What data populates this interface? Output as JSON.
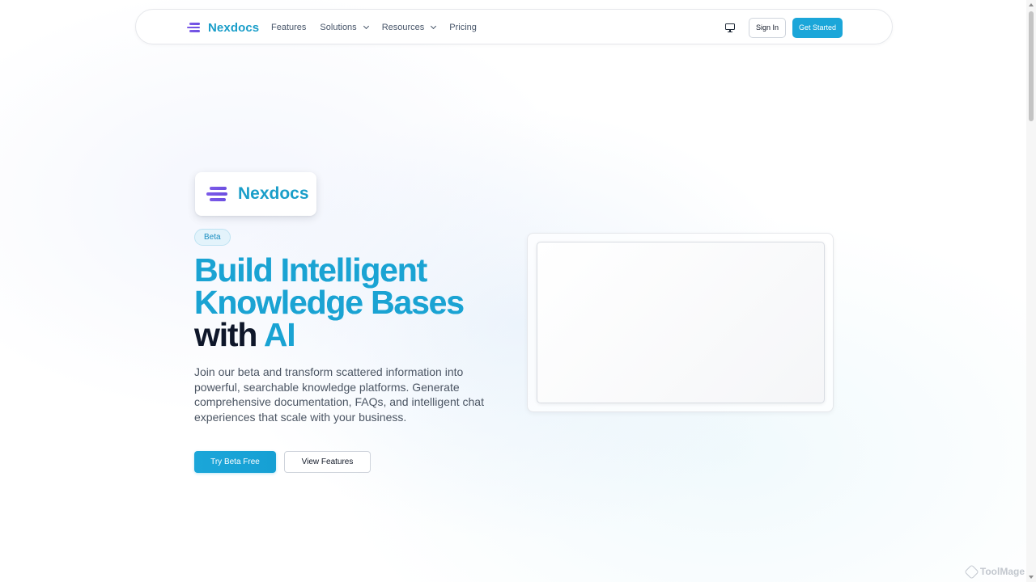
{
  "nav": {
    "brand": "Nexdocs",
    "links": [
      {
        "label": "Features",
        "dropdown": false
      },
      {
        "label": "Solutions",
        "dropdown": true
      },
      {
        "label": "Resources",
        "dropdown": true
      },
      {
        "label": "Pricing",
        "dropdown": false
      }
    ],
    "theme_icon": "monitor-icon",
    "sign_in_label": "Sign In",
    "get_started_label": "Get Started"
  },
  "hero": {
    "logo_brand": "Nexdocs",
    "badge": "Beta",
    "headline_line1": "Build Intelligent",
    "headline_line2": "Knowledge Bases",
    "headline_with": "with",
    "headline_ai": "AI",
    "subtext": "Join our beta and transform scattered information into powerful, searchable knowledge platforms. Generate comprehensive documentation, FAQs, and intelligent chat experiences that scale with your business.",
    "primary_cta": "Try Beta Free",
    "secondary_cta": "View Features"
  },
  "watermark": "ToolMage",
  "colors": {
    "accent": "#1ba6d9",
    "logo_purple": "#7c5ae8",
    "headline_dark": "#0f172a"
  }
}
